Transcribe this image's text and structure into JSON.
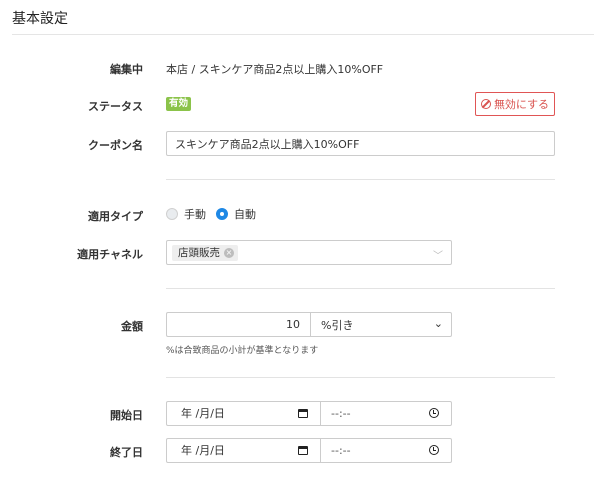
{
  "section": {
    "title": "基本設定"
  },
  "editing": {
    "label": "編集中",
    "value": "本店 / スキンケア商品2点以上購入10%OFF"
  },
  "status": {
    "label": "ステータス",
    "badge": "有効",
    "disable_button": "無効にする",
    "badge_color": "#8bc34a",
    "danger_color": "#d9534f"
  },
  "coupon_name": {
    "label": "クーポン名",
    "value": "スキンケア商品2点以上購入10%OFF"
  },
  "apply_type": {
    "label": "適用タイプ",
    "options": [
      "手動",
      "自動"
    ],
    "selected": "自動",
    "accent_color": "#1e88e5"
  },
  "channel": {
    "label": "適用チャネル",
    "chips": [
      "店頭販売"
    ]
  },
  "amount": {
    "label": "金額",
    "value": "10",
    "unit_selected": "%引き",
    "help": "%は合致商品の小計が基準となります"
  },
  "start": {
    "label": "開始日",
    "date_placeholder": "年 /月/日",
    "time_placeholder": "--:--"
  },
  "end": {
    "label": "終了日",
    "date_placeholder": "年 /月/日",
    "time_placeholder": "--:--"
  }
}
